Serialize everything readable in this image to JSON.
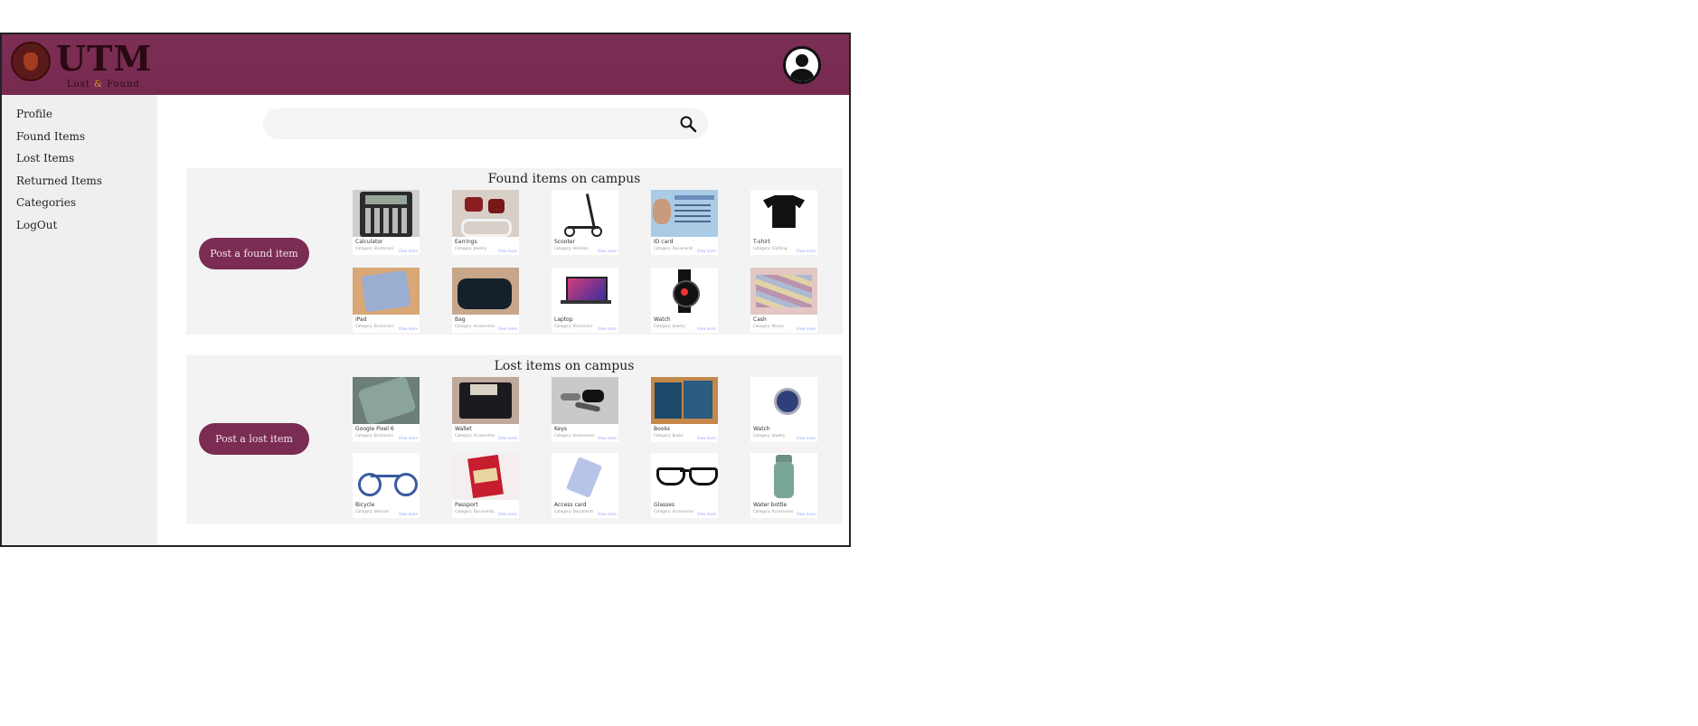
{
  "header": {
    "logo_title": "UTM",
    "logo_sub_left": "Lost",
    "logo_sub_amp": "&",
    "logo_sub_right": "Found",
    "accent": "#7a2c52"
  },
  "sidebar": {
    "items": [
      {
        "label": "Profile"
      },
      {
        "label": "Found Items"
      },
      {
        "label": "Lost Items"
      },
      {
        "label": "Returned Items"
      },
      {
        "label": "Categories"
      },
      {
        "label": "LogOut"
      }
    ]
  },
  "search": {
    "placeholder": "",
    "icon": "search-icon"
  },
  "found": {
    "title": "Found items on campus",
    "button": "Post a found item",
    "items": [
      {
        "name": "Calculator",
        "sub": "Category: Electronics"
      },
      {
        "name": "Earrings",
        "sub": "Category: Jewelry"
      },
      {
        "name": "Scooter",
        "sub": "Category: Vehicles"
      },
      {
        "name": "ID card",
        "sub": "Category: Documents"
      },
      {
        "name": "T-shirt",
        "sub": "Category: Clothing"
      },
      {
        "name": "iPad",
        "sub": "Category: Electronics"
      },
      {
        "name": "Bag",
        "sub": "Category: Accessories"
      },
      {
        "name": "Laptop",
        "sub": "Category: Electronics"
      },
      {
        "name": "Watch",
        "sub": "Category: Jewelry"
      },
      {
        "name": "Cash",
        "sub": "Category: Money"
      }
    ]
  },
  "lost": {
    "title": "Lost items on campus",
    "button": "Post a lost item",
    "items": [
      {
        "name": "Google Pixel 6",
        "sub": "Category: Electronics"
      },
      {
        "name": "Wallet",
        "sub": "Category: Accessories"
      },
      {
        "name": "Keys",
        "sub": "Category: Accessories"
      },
      {
        "name": "Books",
        "sub": "Category: Books"
      },
      {
        "name": "Watch",
        "sub": "Category: Jewelry"
      },
      {
        "name": "Bicycle",
        "sub": "Category: Vehicles"
      },
      {
        "name": "Passport",
        "sub": "Category: Documents"
      },
      {
        "name": "Access card",
        "sub": "Category: Documents"
      },
      {
        "name": "Glasses",
        "sub": "Category: Accessories"
      },
      {
        "name": "Water bottle",
        "sub": "Category: Accessories"
      }
    ]
  },
  "card_more_label": "View more"
}
